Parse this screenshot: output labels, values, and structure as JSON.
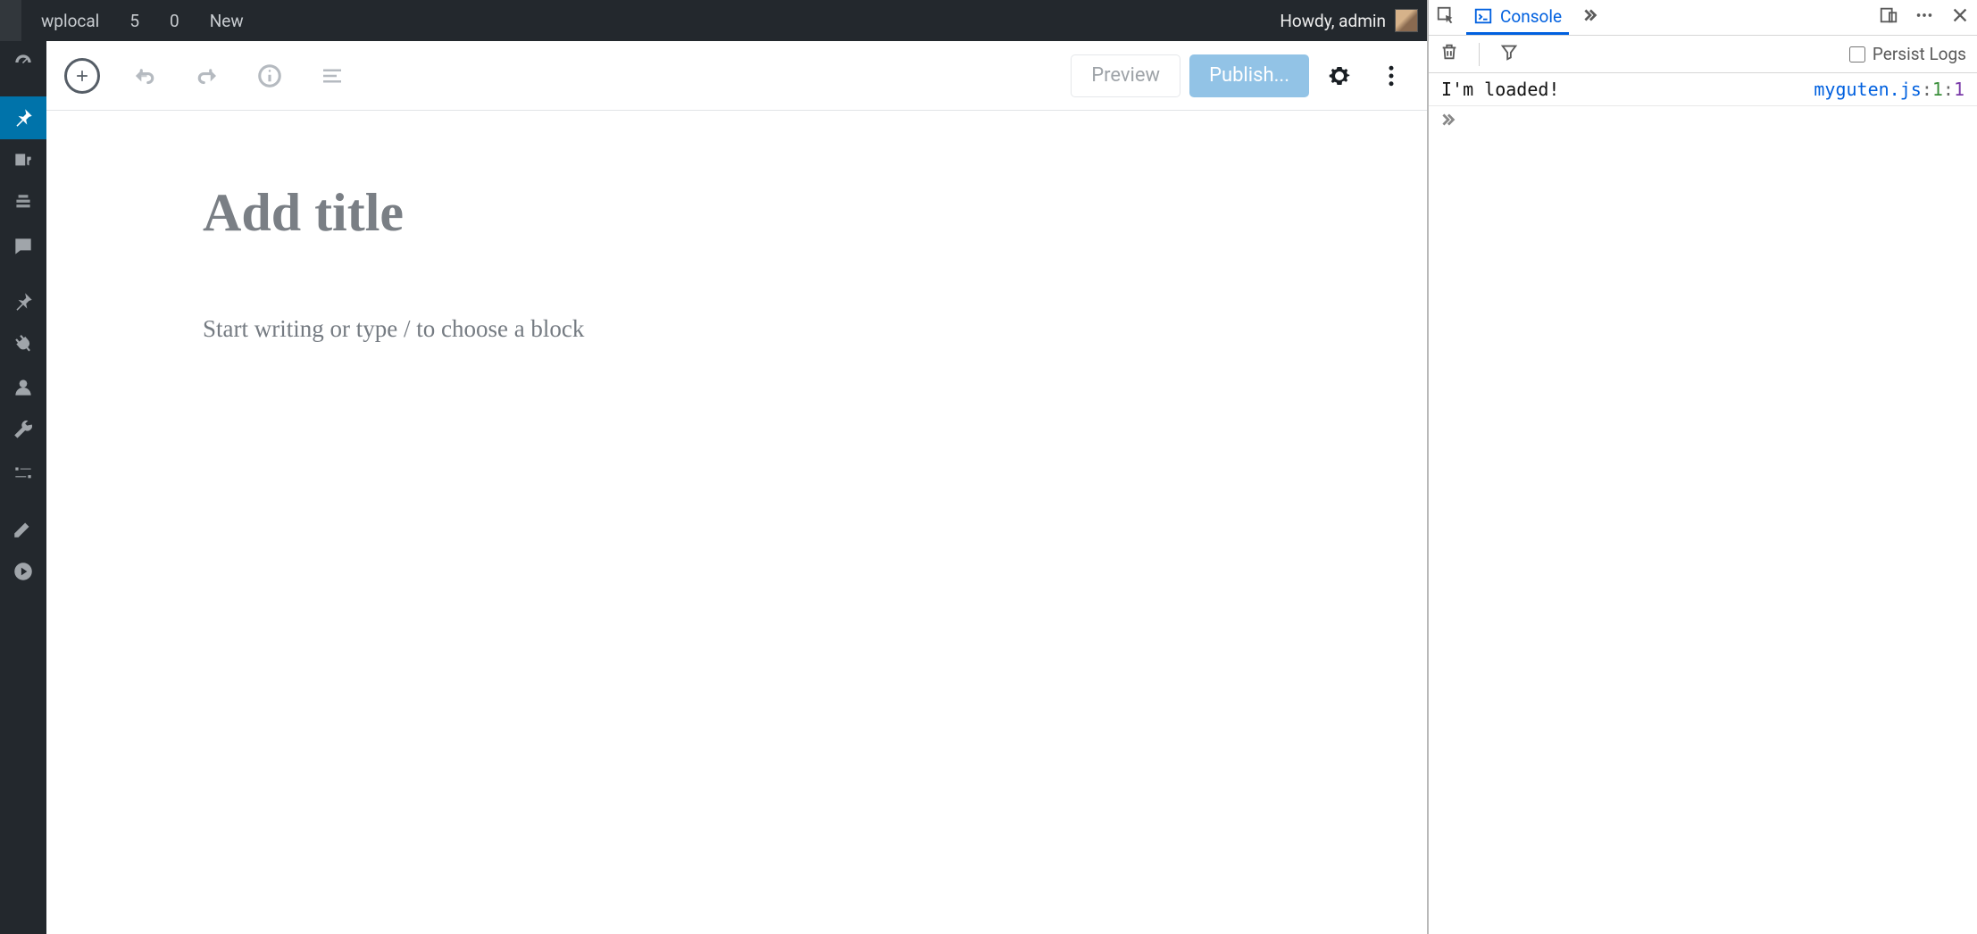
{
  "adminbar": {
    "site_name": "wplocal",
    "updates_count": "5",
    "comments_count": "0",
    "new_label": "New",
    "howdy_prefix": "Howdy,",
    "user_name": "admin"
  },
  "sidebar": {
    "items": [
      {
        "name": "dashboard"
      },
      {
        "name": "posts",
        "current": true
      },
      {
        "name": "media"
      },
      {
        "name": "pages"
      },
      {
        "name": "comments"
      },
      {
        "name": "posts-pin"
      },
      {
        "name": "plugins"
      },
      {
        "name": "users"
      },
      {
        "name": "tools"
      },
      {
        "name": "settings"
      },
      {
        "name": "appearance-edit"
      },
      {
        "name": "playback"
      }
    ]
  },
  "editor": {
    "preview_label": "Preview",
    "publish_label": "Publish...",
    "title_placeholder": "Add title",
    "body_placeholder": "Start writing or type / to choose a block"
  },
  "devtools": {
    "console_tab": "Console",
    "persist_label": "Persist Logs",
    "log": {
      "message": "I'm loaded!",
      "file": "myguten.js",
      "line": "1",
      "col": "1"
    }
  }
}
